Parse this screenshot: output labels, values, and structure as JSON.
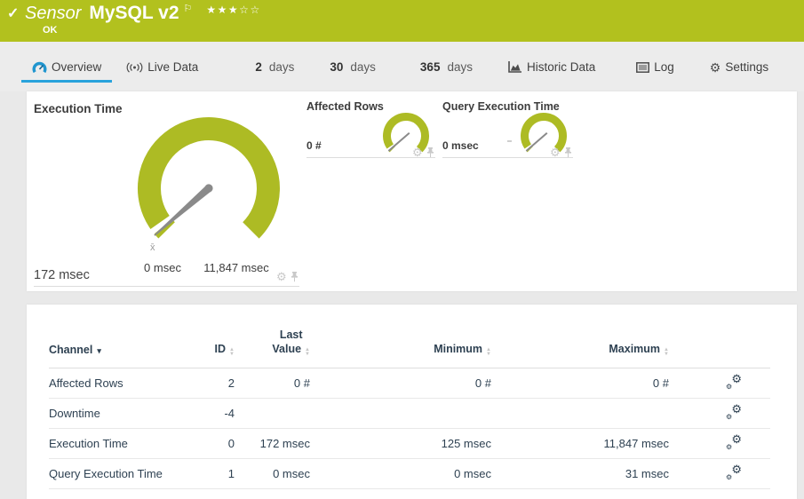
{
  "header": {
    "check_icon": "✓",
    "sensor_label": "Sensor",
    "sensor_name": "MySQL v2",
    "flag_icon": "⚐",
    "stars": "★★★☆☆",
    "status": "OK"
  },
  "tabs": [
    {
      "label": "Overview"
    },
    {
      "label": "Live Data"
    },
    {
      "num": "2",
      "word": "days"
    },
    {
      "num": "30",
      "word": "days"
    },
    {
      "num": "365",
      "word": "days"
    },
    {
      "label": "Historic Data"
    },
    {
      "label": "Log"
    },
    {
      "label": "Settings"
    }
  ],
  "gauges": {
    "main": {
      "title": "Execution Time",
      "value": "172 msec",
      "min_label": "0 msec",
      "max_label": "11,847 msec",
      "avg_marker": "x̄",
      "min": 0,
      "max": 11847,
      "current": 172,
      "unit": "msec"
    },
    "small": [
      {
        "title": "Affected Rows",
        "value": "0 #"
      },
      {
        "title": "Query Execution Time",
        "value": "0 msec"
      }
    ]
  },
  "table": {
    "headers": {
      "channel": "Channel",
      "id": "ID",
      "last_line1": "Last",
      "last_line2": "Value",
      "minimum": "Minimum",
      "maximum": "Maximum"
    },
    "rows": [
      {
        "channel": "Affected Rows",
        "id": "2",
        "last": "0 #",
        "min": "0 #",
        "max": "0 #"
      },
      {
        "channel": "Downtime",
        "id": "-4",
        "last": "",
        "min": "",
        "max": ""
      },
      {
        "channel": "Execution Time",
        "id": "0",
        "last": "172 msec",
        "min": "125 msec",
        "max": "11,847 msec"
      },
      {
        "channel": "Query Execution Time",
        "id": "1",
        "last": "0 msec",
        "min": "0 msec",
        "max": "31 msec"
      }
    ]
  },
  "icons": {
    "sort_up": "▲",
    "sort_down": "▼",
    "channel_sort_caret": "▾",
    "gear": "⚙"
  },
  "colors": {
    "status_ok_green": "#b2c11e",
    "gauge_green": "#adbb24",
    "active_tab_blue": "#29a3dc",
    "table_text": "#2e4152"
  }
}
